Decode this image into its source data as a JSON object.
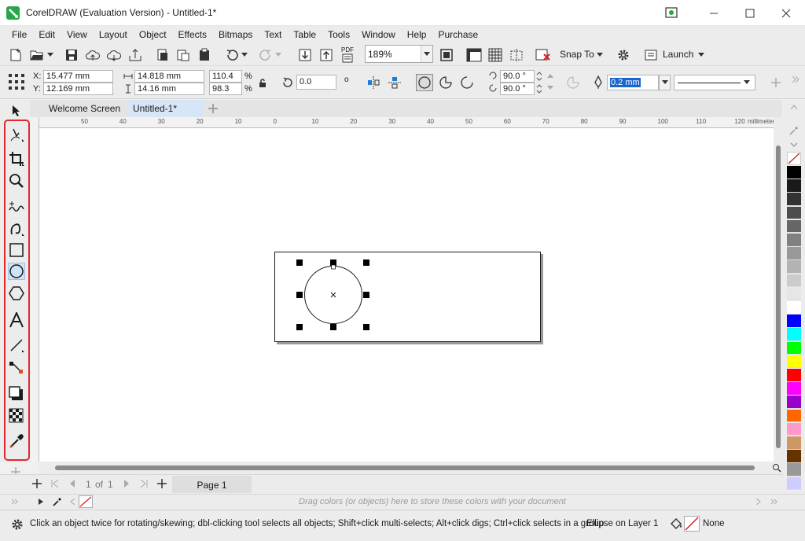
{
  "window": {
    "title": "CorelDRAW (Evaluation Version) - Untitled-1*"
  },
  "menu": [
    "File",
    "Edit",
    "View",
    "Layout",
    "Object",
    "Effects",
    "Bitmaps",
    "Text",
    "Table",
    "Tools",
    "Window",
    "Help",
    "Purchase"
  ],
  "toolbar": {
    "zoom": "189%",
    "pdf_label": "PDF",
    "snap_label": "Snap To",
    "launch_label": "Launch"
  },
  "propbar": {
    "x_label": "X:",
    "x_value": "15.477 mm",
    "y_label": "Y:",
    "y_value": "12.169 mm",
    "width_value": "14.818 mm",
    "height_value": "14.16 mm",
    "scale_x": "110.4",
    "scale_y": "98.3",
    "percent": "%",
    "rotation": "0.0",
    "degree": "o",
    "angle_start": "90.0 °",
    "angle_end": "90.0 °",
    "outline_width": "0.2 mm"
  },
  "tabs": [
    {
      "label": "Welcome Screen",
      "active": false
    },
    {
      "label": "Untitled-1*",
      "active": true
    }
  ],
  "ruler": {
    "h_ticks": [
      "50",
      "40",
      "30",
      "20",
      "10",
      "0",
      "10",
      "20",
      "30",
      "40",
      "50",
      "60",
      "70",
      "80",
      "90",
      "100",
      "110",
      "120"
    ],
    "unit": "millimeters"
  },
  "pagenav": {
    "current": "1",
    "of_label": "of",
    "total": "1",
    "page_tab": "Page 1"
  },
  "docpalette": {
    "hint": "Drag colors (or objects) here to store these colors with your document"
  },
  "status": {
    "hint": "Click an object twice for rotating/skewing; dbl-clicking tool selects all objects; Shift+click multi-selects; Alt+click digs; Ctrl+click selects in a group",
    "object": "Ellipse on Layer 1",
    "fill": "None"
  },
  "palette_colors": [
    "#000000",
    "#1a1a1a",
    "#333333",
    "#4d4d4d",
    "#666666",
    "#808080",
    "#999999",
    "#b3b3b3",
    "#cccccc",
    "#e6e6e6",
    "#ffffff",
    "#0000ff",
    "#00ffff",
    "#00ff00",
    "#ffff00",
    "#ff0000",
    "#ff00ff",
    "#9900cc",
    "#ff6600",
    "#ff99cc",
    "#cc9966",
    "#663300",
    "#999999",
    "#ccccff"
  ]
}
